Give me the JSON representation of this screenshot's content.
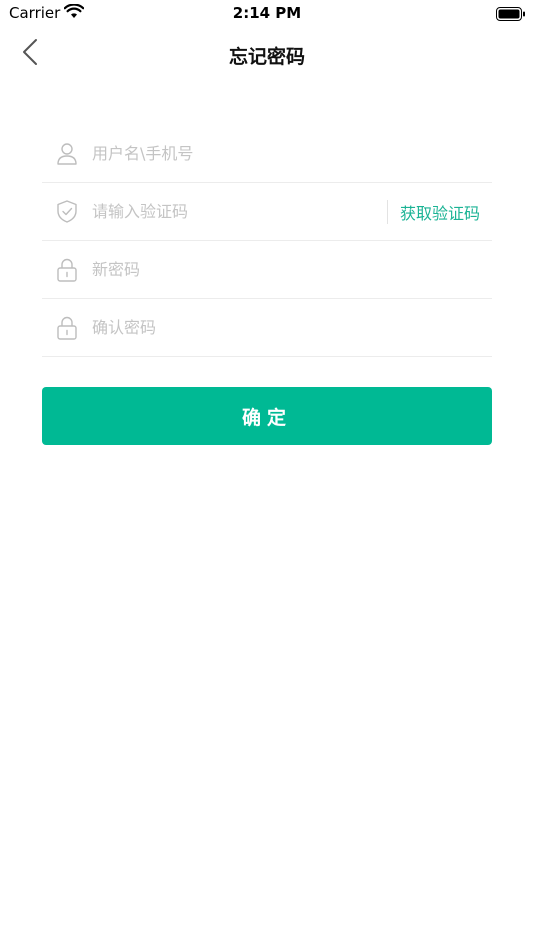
{
  "status_bar": {
    "carrier": "Carrier",
    "time": "2:14 PM",
    "wifi_icon": "wifi-icon",
    "battery_icon": "battery-icon"
  },
  "nav": {
    "back_icon": "chevron-left-icon",
    "title": "忘记密码"
  },
  "form": {
    "username": {
      "placeholder": "用户名\\手机号",
      "value": "",
      "icon": "user-icon"
    },
    "verify_code": {
      "placeholder": "请输入验证码",
      "value": "",
      "icon": "shield-check-icon",
      "action_label": "获取验证码"
    },
    "new_password": {
      "placeholder": "新密码",
      "value": "",
      "icon": "lock-icon"
    },
    "confirm_password": {
      "placeholder": "确认密码",
      "value": "",
      "icon": "lock-icon"
    }
  },
  "submit_label": "确定",
  "colors": {
    "accent": "#00b994",
    "link": "#1ab394",
    "placeholder": "#c4c4c4",
    "divider": "#ececec"
  }
}
